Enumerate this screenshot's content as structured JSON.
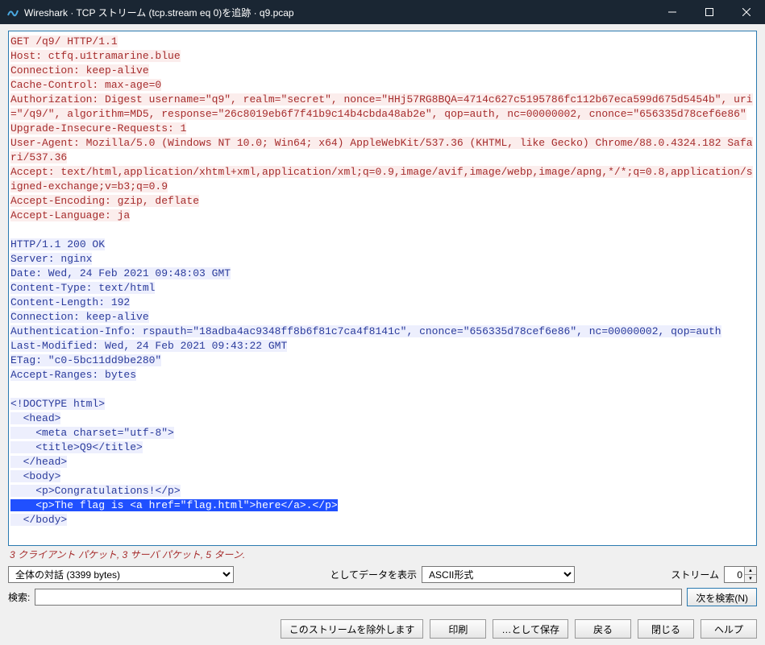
{
  "titlebar": {
    "text": "Wireshark · TCP ストリーム (tcp.stream eq 0)を追跡 · q9.pcap"
  },
  "stream": {
    "request": "GET /q9/ HTTP/1.1\nHost: ctfq.u1tramarine.blue\nConnection: keep-alive\nCache-Control: max-age=0\nAuthorization: Digest username=\"q9\", realm=\"secret\", nonce=\"HHj57RG8BQA=4714c627c5195786fc112b67eca599d675d5454b\", uri=\"/q9/\", algorithm=MD5, response=\"26c8019eb6f7f41b9c14b4cbda48ab2e\", qop=auth, nc=00000002, cnonce=\"656335d78cef6e86\"\nUpgrade-Insecure-Requests: 1\nUser-Agent: Mozilla/5.0 (Windows NT 10.0; Win64; x64) AppleWebKit/537.36 (KHTML, like Gecko) Chrome/88.0.4324.182 Safari/537.36\nAccept: text/html,application/xhtml+xml,application/xml;q=0.9,image/avif,image/webp,image/apng,*/*;q=0.8,application/signed-exchange;v=b3;q=0.9\nAccept-Encoding: gzip, deflate\nAccept-Language: ja",
    "response_head": "HTTP/1.1 200 OK\nServer: nginx\nDate: Wed, 24 Feb 2021 09:48:03 GMT\nContent-Type: text/html\nContent-Length: 192\nConnection: keep-alive\nAuthentication-Info: rspauth=\"18adba4ac9348ff8b6f81c7ca4f8141c\", cnonce=\"656335d78cef6e86\", nc=00000002, qop=auth\nLast-Modified: Wed, 24 Feb 2021 09:43:22 GMT\nETag: \"c0-5bc11dd9be280\"\nAccept-Ranges: bytes",
    "body_pre": "<!DOCTYPE html>\n  <head>\n    <meta charset=\"utf-8\">\n    <title>Q9</title>\n  </head>\n  <body>\n    <p>Congratulations!</p>",
    "body_sel": "    <p>The flag is <a href=\"flag.html\">here</a>.</p>",
    "body_post": "  </body>"
  },
  "status_line": "3 クライアント パケット, 3 サーバ パケット, 5 ターン.",
  "controls": {
    "conversation_label": "全体の対話 (3399 bytes)",
    "show_as_label": "としてデータを表示",
    "format": "ASCII形式",
    "stream_label": "ストリーム",
    "stream_value": "0",
    "search_label": "検索:",
    "search_value": "",
    "find_next": "次を検索(N)"
  },
  "buttons": {
    "filter_out": "このストリームを除外します",
    "print": "印刷",
    "save_as": "…として保存",
    "back": "戻る",
    "close": "閉じる",
    "help": "ヘルプ"
  }
}
